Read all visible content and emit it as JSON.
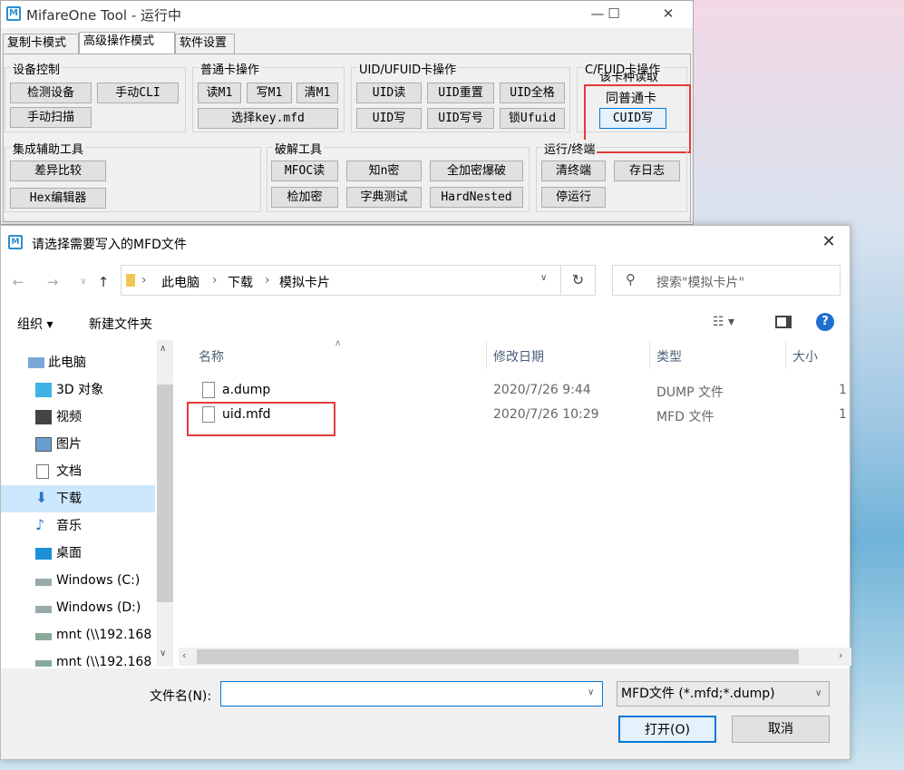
{
  "app": {
    "title": "MifareOne Tool - 运行中",
    "tabs": [
      "复制卡模式",
      "高级操作模式",
      "软件设置"
    ],
    "active_tab": 1,
    "groups": {
      "device": {
        "title": "设备控制",
        "buttons": [
          "检测设备",
          "手动CLI",
          "手动扫描"
        ]
      },
      "normal": {
        "title": "普通卡操作",
        "buttons": [
          "读M1",
          "写M1",
          "清M1",
          "选择key.mfd"
        ]
      },
      "uid": {
        "title": "UID/UFUID卡操作",
        "buttons": [
          "UID读",
          "UID重置",
          "UID全格",
          "UID写",
          "UID写号",
          "锁Ufuid"
        ]
      },
      "cfuid": {
        "title": "C/FUID卡操作",
        "text1": "该卡种读取",
        "text2": "同普通卡",
        "buttons": [
          "CUID写"
        ]
      },
      "tools": {
        "title": "集成辅助工具",
        "buttons": [
          "差异比较",
          "Hex编辑器"
        ]
      },
      "crack": {
        "title": "破解工具",
        "buttons": [
          "MFOC读",
          "知n密",
          "全加密爆破",
          "检加密",
          "字典测试",
          "HardNested"
        ]
      },
      "run": {
        "title": "运行/终端",
        "buttons": [
          "清终端",
          "存日志",
          "停运行"
        ]
      }
    }
  },
  "dialog": {
    "title": "请选择需要写入的MFD文件",
    "breadcrumb": [
      "此电脑",
      "下载",
      "模拟卡片"
    ],
    "search_placeholder": "搜索\"模拟卡片\"",
    "toolbar": {
      "organize": "组织 ▾",
      "new_folder": "新建文件夹"
    },
    "sidebar": [
      "此电脑",
      "3D 对象",
      "视频",
      "图片",
      "文档",
      "下载",
      "音乐",
      "桌面",
      "Windows (C:)",
      "Windows (D:)",
      "mnt (\\\\192.168",
      "mnt (\\\\192.168"
    ],
    "selected_sidebar": 5,
    "columns": [
      "名称",
      "修改日期",
      "类型",
      "大小"
    ],
    "files": [
      {
        "name": "a.dump",
        "date": "2020/7/26 9:44",
        "type": "DUMP 文件",
        "size": "1"
      },
      {
        "name": "uid.mfd",
        "date": "2020/7/26 10:29",
        "type": "MFD 文件",
        "size": "1"
      }
    ],
    "filename_label": "文件名(N):",
    "filename_value": "",
    "filter": "MFD文件 (*.mfd;*.dump)",
    "open_label": "打开(O)",
    "cancel_label": "取消"
  }
}
